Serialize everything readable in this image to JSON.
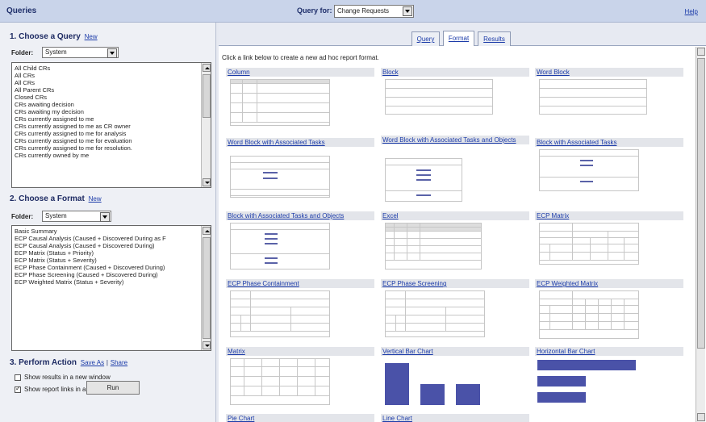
{
  "topbar": {
    "title": "Queries",
    "query_for_label": "Query for:",
    "query_for_value": "Change Requests",
    "help": "Help"
  },
  "section1": {
    "title": "1. Choose a Query",
    "new_link": "New",
    "folder_label": "Folder:",
    "folder_value": "System"
  },
  "queries": [
    "All Child CRs",
    "All CRs",
    "All CRs",
    "All Parent CRs",
    "Closed CRs",
    "CRs awaiting decision",
    "CRs awaiting my decision",
    "CRs currently assigned to me",
    "CRs currently assigned to me as CR owner",
    "CRs currently assigned to me for analysis",
    "CRs currently assigned to me for evaluation",
    "CRs currently assigned to me for resolution.",
    "CRs currently owned by me"
  ],
  "section2": {
    "title": "2. Choose a Format",
    "new_link": "New",
    "folder_label": "Folder:",
    "folder_value": "System"
  },
  "formats": [
    "Basic Summary",
    "ECP Causal Analysis (Caused + Discovered During as F",
    "ECP Causal Analysis (Caused + Discovered During)",
    "ECP Matrix (Status + Priority)",
    "ECP Matrix (Status + Severity)",
    "ECP Phase Containment (Caused + Discovered During)",
    "ECP Phase Screening (Caused + Discovered During)",
    "ECP Weighted Matrix (Status + Severity)"
  ],
  "section3": {
    "title": "3. Perform Action",
    "save_as": "Save As",
    "sep": "|",
    "share": "Share",
    "opt1": "Show results in a new window",
    "opt2": "Show report links in a new window",
    "run": "Run"
  },
  "tabs": {
    "query": "Query",
    "format": "Format",
    "results": "Results"
  },
  "instruction": "Click a link below to create a new ad hoc report format.",
  "cards": [
    "Column",
    "Block",
    "Word Block",
    "Word Block with Associated Tasks",
    "Word Block with Associated Tasks and Objects",
    "Block with Associated Tasks",
    "Block with Associated Tasks and Objects",
    "Excel",
    "ECP Matrix",
    "ECP Phase Containment",
    "ECP Phase Screening",
    "ECP Weighted Matrix",
    "Matrix",
    "Vertical Bar Chart",
    "Horizontal Bar Chart",
    "Pie Chart",
    "Line Chart"
  ],
  "colors": {
    "bar": "#4a52a8",
    "link": "#1a3aa8",
    "topbar": "#c9d4ea"
  }
}
